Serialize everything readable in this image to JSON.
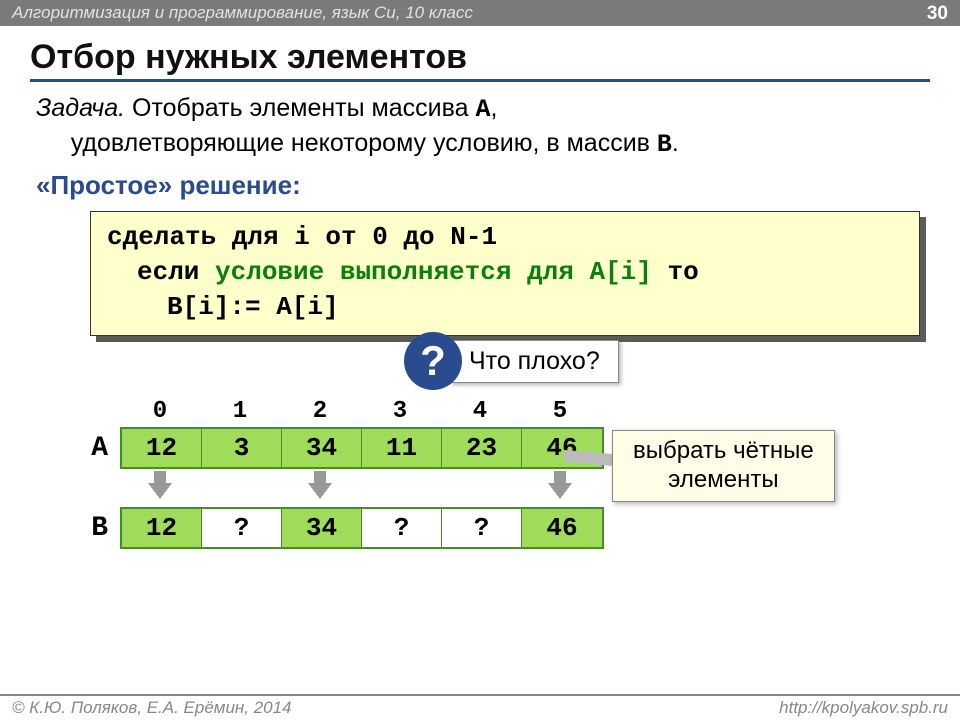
{
  "header": {
    "course": "Алгоритмизация и программирование, язык Си, 10 класс",
    "page": "30"
  },
  "title": "Отбор нужных элементов",
  "task": {
    "label": "Задача.",
    "line1_a": " Отобрать элементы массива ",
    "arrA": "A",
    "line1_b": ",",
    "line2_a": "удовлетворяющие некоторому условию, в массив ",
    "arrB": "B",
    "line2_b": "."
  },
  "subhead": "«Простое» решение:",
  "code": {
    "l1a": "сделать для i от 0 до N-1",
    "l2a": "если ",
    "l2green": "условие выполняется для A[i]",
    "l2b": " то",
    "l3": "B[i]:= A[i]"
  },
  "question": {
    "mark": "?",
    "text": "Что плохо?"
  },
  "arrays": {
    "indices": [
      "0",
      "1",
      "2",
      "3",
      "4",
      "5"
    ],
    "labelA": "A",
    "labelB": "B",
    "A": [
      "12",
      "3",
      "34",
      "11",
      "23",
      "46"
    ],
    "B": [
      "12",
      "?",
      "34",
      "?",
      "?",
      "46"
    ],
    "B_green": [
      true,
      false,
      true,
      false,
      false,
      true
    ],
    "arrows": [
      true,
      false,
      true,
      false,
      false,
      true
    ]
  },
  "sideNote": {
    "l1": "выбрать чётные",
    "l2": "элементы"
  },
  "footer": {
    "left": "© К.Ю. Поляков, Е.А. Ерёмин, 2014",
    "right": "http://kpolyakov.spb.ru"
  }
}
